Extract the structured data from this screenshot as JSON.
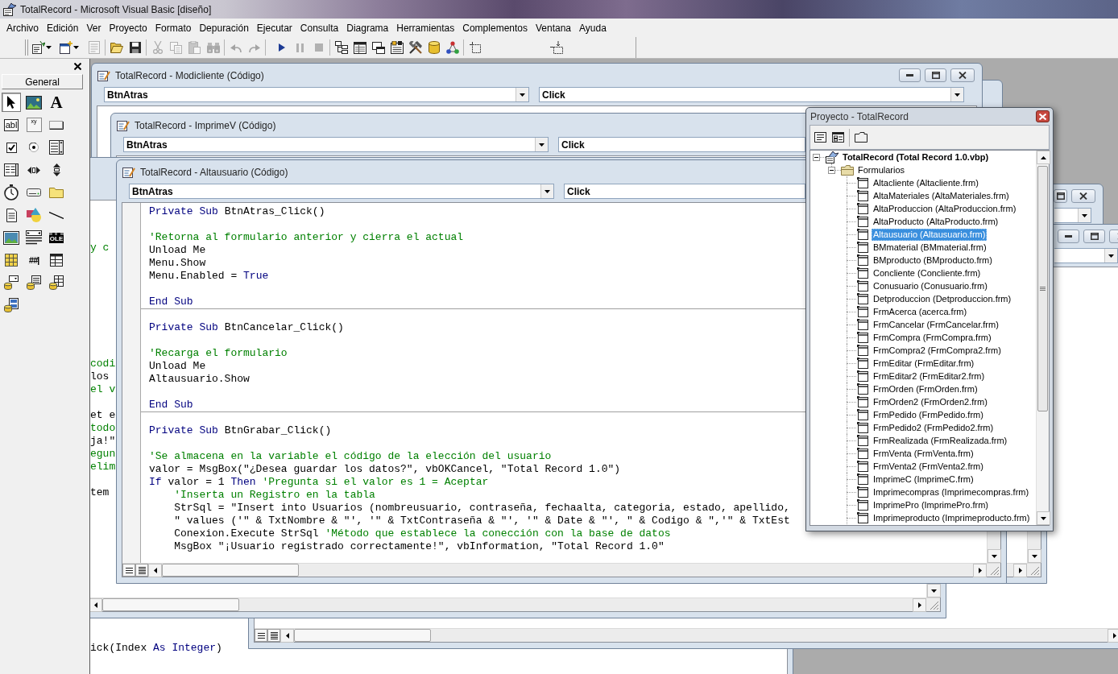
{
  "window": {
    "title": "TotalRecord - Microsoft Visual Basic [diseño]"
  },
  "menu": [
    "Archivo",
    "Edición",
    "Ver",
    "Proyecto",
    "Formato",
    "Depuración",
    "Ejecutar",
    "Consulta",
    "Diagrama",
    "Herramientas",
    "Complementos",
    "Ventana",
    "Ayuda"
  ],
  "toolbar": [
    {
      "kind": "project",
      "menu": true,
      "disabled": false
    },
    {
      "kind": "form",
      "menu": true,
      "disabled": false
    },
    {
      "kind": "menu",
      "disabled": true
    },
    {
      "kind": "separator"
    },
    {
      "kind": "open",
      "disabled": false
    },
    {
      "kind": "save",
      "disabled": false
    },
    {
      "kind": "separator"
    },
    {
      "kind": "cut",
      "disabled": true
    },
    {
      "kind": "copy",
      "disabled": true
    },
    {
      "kind": "paste",
      "disabled": true
    },
    {
      "kind": "find",
      "disabled": true
    },
    {
      "kind": "separator"
    },
    {
      "kind": "undo",
      "disabled": true
    },
    {
      "kind": "redo",
      "disabled": true
    },
    {
      "kind": "separator"
    },
    {
      "kind": "start",
      "disabled": false
    },
    {
      "kind": "pause",
      "disabled": true
    },
    {
      "kind": "stop",
      "disabled": true
    },
    {
      "kind": "separator"
    },
    {
      "kind": "explorer",
      "disabled": false
    },
    {
      "kind": "properties",
      "disabled": false
    },
    {
      "kind": "layout",
      "disabled": false
    },
    {
      "kind": "browser",
      "disabled": false
    },
    {
      "kind": "toolbox",
      "disabled": false
    },
    {
      "kind": "dataview",
      "disabled": false
    },
    {
      "kind": "components",
      "disabled": false
    },
    {
      "kind": "separator"
    },
    {
      "kind": "control",
      "disabled": false
    },
    {
      "kind": "position",
      "disabled": false
    }
  ],
  "toolbox": {
    "tab": "General",
    "tools": [
      {
        "kind": "pointer",
        "selected": true
      },
      {
        "kind": "picture",
        "selected": false
      },
      {
        "kind": "label",
        "glyph": "A",
        "selected": false
      },
      {
        "kind": "textbox",
        "glyph": "abl",
        "selected": false
      },
      {
        "kind": "frame",
        "glyph": "xy",
        "selected": false
      },
      {
        "kind": "command",
        "selected": false
      },
      {
        "kind": "checkbox",
        "selected": false
      },
      {
        "kind": "option",
        "selected": false
      },
      {
        "kind": "combo",
        "selected": false
      },
      {
        "kind": "list",
        "selected": false
      },
      {
        "kind": "hscroll",
        "selected": false
      },
      {
        "kind": "vscroll",
        "selected": false
      },
      {
        "kind": "timer",
        "selected": false
      },
      {
        "kind": "drive",
        "selected": false
      },
      {
        "kind": "dir",
        "selected": false
      },
      {
        "kind": "file",
        "selected": false
      },
      {
        "kind": "shape",
        "selected": false
      },
      {
        "kind": "line",
        "selected": false
      },
      {
        "kind": "image",
        "selected": false
      },
      {
        "kind": "data",
        "selected": false
      },
      {
        "kind": "ole",
        "glyph": "OLE",
        "selected": false
      },
      {
        "kind": "grid",
        "selected": false
      },
      {
        "kind": "masked",
        "glyph": "##|",
        "selected": false
      },
      {
        "kind": "dbgrid",
        "selected": false
      },
      {
        "kind": "dbcombo",
        "selected": false
      },
      {
        "kind": "dblist",
        "selected": false
      },
      {
        "kind": "datagrid",
        "selected": false
      },
      {
        "kind": "repeater",
        "selected": false
      }
    ]
  },
  "code_windows": [
    {
      "title": "TotalRecord - Modicliente (Código)",
      "object": "BtnAtras",
      "procedure": "Click"
    },
    {
      "title": "TotalRecord - ImprimeV (Código)",
      "object": "BtnAtras",
      "procedure": "Click"
    },
    {
      "title": "TotalRecord - Altausuario (Código)",
      "object": "BtnAtras",
      "procedure": "Click",
      "procedures": [
        {
          "lines": [
            {
              "kind": "code",
              "tokens": [
                {
                  "kind": "keyword",
                  "text": "Private Sub"
                },
                {
                  "kind": "plain",
                  "text": " BtnAtras_Click()"
                }
              ]
            },
            {
              "kind": "blank"
            },
            {
              "kind": "code",
              "tokens": [
                {
                  "kind": "comment",
                  "text": "'Retorna al formulario anterior y cierra el actual"
                }
              ]
            },
            {
              "kind": "code",
              "tokens": [
                {
                  "kind": "plain",
                  "text": "Unload Me"
                }
              ]
            },
            {
              "kind": "code",
              "tokens": [
                {
                  "kind": "plain",
                  "text": "Menu.Show"
                }
              ]
            },
            {
              "kind": "code",
              "tokens": [
                {
                  "kind": "plain",
                  "text": "Menu.Enabled = "
                },
                {
                  "kind": "keyword",
                  "text": "True"
                }
              ]
            },
            {
              "kind": "blank"
            },
            {
              "kind": "code",
              "tokens": [
                {
                  "kind": "keyword",
                  "text": "End Sub"
                }
              ]
            }
          ]
        },
        {
          "lines": [
            {
              "kind": "blank"
            },
            {
              "kind": "code",
              "tokens": [
                {
                  "kind": "keyword",
                  "text": "Private Sub"
                },
                {
                  "kind": "plain",
                  "text": " BtnCancelar_Click()"
                }
              ]
            },
            {
              "kind": "blank"
            },
            {
              "kind": "code",
              "tokens": [
                {
                  "kind": "comment",
                  "text": "'Recarga el formulario"
                }
              ]
            },
            {
              "kind": "code",
              "tokens": [
                {
                  "kind": "plain",
                  "text": "Unload Me"
                }
              ]
            },
            {
              "kind": "code",
              "tokens": [
                {
                  "kind": "plain",
                  "text": "Altausuario.Show"
                }
              ]
            },
            {
              "kind": "blank"
            },
            {
              "kind": "code",
              "tokens": [
                {
                  "kind": "keyword",
                  "text": "End Sub"
                }
              ]
            }
          ]
        },
        {
          "lines": [
            {
              "kind": "blank"
            },
            {
              "kind": "code",
              "tokens": [
                {
                  "kind": "keyword",
                  "text": "Private Sub"
                },
                {
                  "kind": "plain",
                  "text": " BtnGrabar_Click()"
                }
              ]
            },
            {
              "kind": "blank"
            },
            {
              "kind": "code",
              "tokens": [
                {
                  "kind": "comment",
                  "text": "'Se almacena en la variable el código de la elección del usuario"
                }
              ]
            },
            {
              "kind": "code",
              "tokens": [
                {
                  "kind": "plain",
                  "text": "valor = MsgBox(\"¿Desea guardar los datos?\", vbOKCancel, \"Total Record 1.0\")"
                }
              ]
            },
            {
              "kind": "code",
              "tokens": [
                {
                  "kind": "keyword",
                  "text": "If"
                },
                {
                  "kind": "plain",
                  "text": " valor = 1 "
                },
                {
                  "kind": "keyword",
                  "text": "Then"
                },
                {
                  "kind": "comment",
                  "text": " 'Pregunta si el valor es 1 = Aceptar"
                }
              ],
              "children": [
                {
                  "kind": "code",
                  "tokens": [
                    {
                      "kind": "comment",
                      "text": "'Inserta un Registro en la tabla"
                    }
                  ]
                },
                {
                  "kind": "code",
                  "tokens": [
                    {
                      "kind": "plain",
                      "text": "StrSql = \"Insert into Usuarios (nombreusuario, contraseña, fechaalta, categoria, estado, apellido,"
                    }
                  ]
                },
                {
                  "kind": "code",
                  "tokens": [
                    {
                      "kind": "plain",
                      "text": "\" values ('\" & TxtNombre & \"', '\" & TxtContraseña & \"', '\" & Date & \"', \" & Codigo & \",'\" & TxtEst"
                    }
                  ]
                },
                {
                  "kind": "code",
                  "tokens": [
                    {
                      "kind": "plain",
                      "text": "Conexion.Execute StrSql "
                    },
                    {
                      "kind": "comment",
                      "text": "'Método que establece la conección con la base de datos"
                    }
                  ]
                },
                {
                  "kind": "code",
                  "tokens": [
                    {
                      "kind": "plain",
                      "text": "MsgBox \"¡Usuario registrado correctamente!\", vbInformation, \"Total Record 1.0\""
                    }
                  ]
                }
              ]
            }
          ]
        }
      ]
    },
    {
      "procedures": [
        {
          "lines": [
            {
              "kind": "code",
              "tokens": [
                {
                  "kind": "comment",
                  "text": "y c"
                }
              ]
            },
            {
              "kind": "blank"
            },
            {
              "kind": "blank"
            },
            {
              "kind": "blank"
            },
            {
              "kind": "blank"
            },
            {
              "kind": "blank"
            },
            {
              "kind": "blank"
            },
            {
              "kind": "blank"
            },
            {
              "kind": "blank"
            },
            {
              "kind": "code",
              "tokens": [
                {
                  "kind": "comment",
                  "text": "codi"
                }
              ]
            },
            {
              "kind": "code",
              "tokens": [
                {
                  "kind": "plain",
                  "text": "los"
                }
              ]
            },
            {
              "kind": "code",
              "tokens": [
                {
                  "kind": "comment",
                  "text": "el v"
                }
              ]
            },
            {
              "kind": "blank"
            },
            {
              "kind": "code",
              "tokens": [
                {
                  "kind": "plain",
                  "text": "et e"
                }
              ]
            },
            {
              "kind": "code",
              "tokens": [
                {
                  "kind": "comment",
                  "text": "todo"
                }
              ]
            },
            {
              "kind": "code",
              "tokens": [
                {
                  "kind": "plain",
                  "text": "ja!\""
                }
              ]
            },
            {
              "kind": "code",
              "tokens": [
                {
                  "kind": "comment",
                  "text": "egun"
                }
              ]
            },
            {
              "kind": "code",
              "tokens": [
                {
                  "kind": "comment",
                  "text": "elim"
                }
              ]
            },
            {
              "kind": "blank"
            },
            {
              "kind": "code",
              "tokens": [
                {
                  "kind": "plain",
                  "text": "tem"
                }
              ]
            }
          ]
        }
      ]
    },
    {
      "procedures": [
        {
          "lines": [
            {
              "kind": "code",
              "tokens": [
                {
                  "kind": "plain",
                  "text": "ick(Index "
                },
                {
                  "kind": "keyword",
                  "text": "As Integer"
                },
                {
                  "kind": "plain",
                  "text": ")"
                }
              ]
            }
          ]
        }
      ]
    }
  ],
  "project_explorer": {
    "title": "Proyecto - TotalRecord",
    "toolbar": [
      {
        "kind": "code"
      },
      {
        "kind": "object"
      },
      {
        "kind": "separator"
      },
      {
        "kind": "folders"
      }
    ],
    "tree": [
      {
        "kind": "project",
        "label": "TotalRecord (Total Record 1.0.vbp)",
        "expanded": true,
        "selected": false,
        "children": [
          {
            "kind": "folder",
            "label": "Formularios",
            "expanded": true,
            "selected": false,
            "children": [
              {
                "kind": "form",
                "label": "Altacliente (Altacliente.frm)",
                "selected": false
              },
              {
                "kind": "form",
                "label": "AltaMateriales (AltaMateriales.frm)",
                "selected": false
              },
              {
                "kind": "form",
                "label": "AltaProduccion (AltaProduccion.frm)",
                "selected": false
              },
              {
                "kind": "form",
                "label": "AltaProducto (AltaProducto.frm)",
                "selected": false
              },
              {
                "kind": "form",
                "label": "Altausuario (Altausuario.frm)",
                "selected": true
              },
              {
                "kind": "form",
                "label": "BMmaterial (BMmaterial.frm)",
                "selected": false
              },
              {
                "kind": "form",
                "label": "BMproducto (BMproducto.frm)",
                "selected": false
              },
              {
                "kind": "form",
                "label": "Concliente (Concliente.frm)",
                "selected": false
              },
              {
                "kind": "form",
                "label": "Conusuario (Conusuario.frm)",
                "selected": false
              },
              {
                "kind": "form",
                "label": "Detproduccion (Detproduccion.frm)",
                "selected": false
              },
              {
                "kind": "form",
                "label": "FrmAcerca (acerca.frm)",
                "selected": false
              },
              {
                "kind": "form",
                "label": "FrmCancelar (FrmCancelar.frm)",
                "selected": false
              },
              {
                "kind": "form",
                "label": "FrmCompra (FrmCompra.frm)",
                "selected": false
              },
              {
                "kind": "form",
                "label": "FrmCompra2 (FrmCompra2.frm)",
                "selected": false
              },
              {
                "kind": "form",
                "label": "FrmEditar (FrmEditar.frm)",
                "selected": false
              },
              {
                "kind": "form",
                "label": "FrmEditar2 (FrmEditar2.frm)",
                "selected": false
              },
              {
                "kind": "form",
                "label": "FrmOrden (FrmOrden.frm)",
                "selected": false
              },
              {
                "kind": "form",
                "label": "FrmOrden2 (FrmOrden2.frm)",
                "selected": false
              },
              {
                "kind": "form",
                "label": "FrmPedido (FrmPedido.frm)",
                "selected": false
              },
              {
                "kind": "form",
                "label": "FrmPedido2 (FrmPedido2.frm)",
                "selected": false
              },
              {
                "kind": "form",
                "label": "FrmRealizada (FrmRealizada.frm)",
                "selected": false
              },
              {
                "kind": "form",
                "label": "FrmVenta (FrmVenta.frm)",
                "selected": false
              },
              {
                "kind": "form",
                "label": "FrmVenta2 (FrmVenta2.frm)",
                "selected": false
              },
              {
                "kind": "form",
                "label": "ImprimeC (ImprimeC.frm)",
                "selected": false
              },
              {
                "kind": "form",
                "label": "Imprimecompras (Imprimecompras.frm)",
                "selected": false
              },
              {
                "kind": "form",
                "label": "ImprimePro (ImprimePro.frm)",
                "selected": false
              },
              {
                "kind": "form",
                "label": "Imprimeproducto (Imprimeproducto.frm)",
                "selected": false
              }
            ]
          }
        ]
      }
    ]
  }
}
